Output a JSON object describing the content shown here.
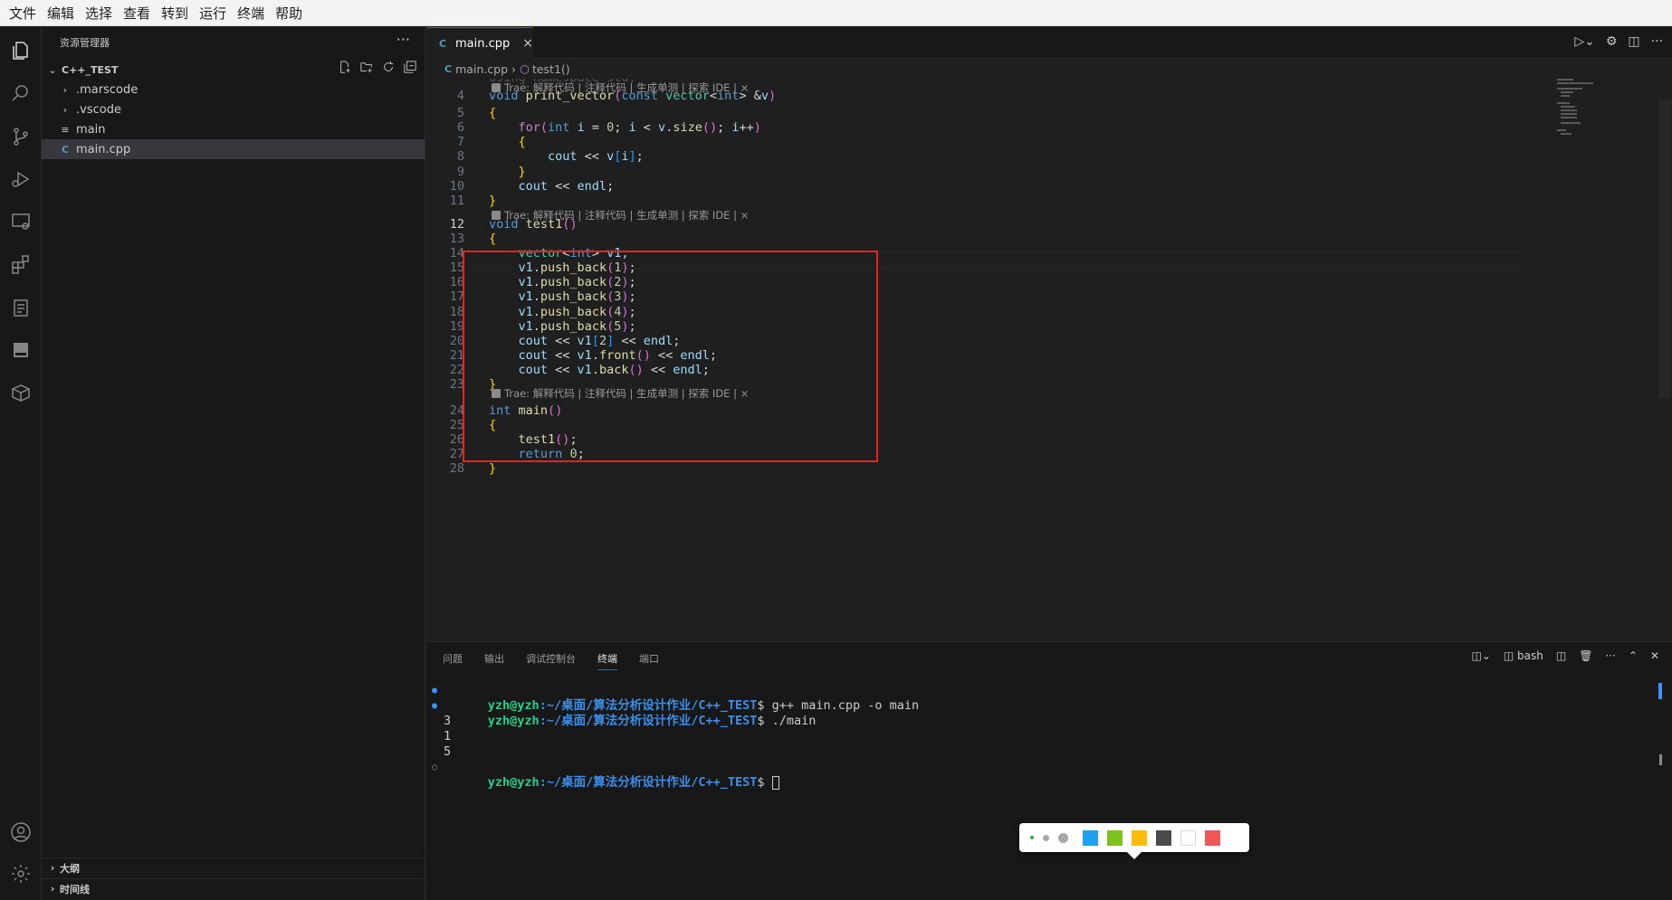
{
  "menubar": [
    "文件",
    "编辑",
    "选择",
    "查看",
    "转到",
    "运行",
    "终端",
    "帮助"
  ],
  "sidebar": {
    "title": "资源管理器",
    "more": "···",
    "folder": "C++_TEST",
    "items": [
      {
        "label": ".marscode",
        "icon": "›"
      },
      {
        "label": ".vscode",
        "icon": "›"
      },
      {
        "label": "main",
        "icon": "≡"
      },
      {
        "label": "main.cpp",
        "icon": "C"
      }
    ],
    "bottom": [
      "大纲",
      "时间线"
    ]
  },
  "tab": {
    "label": "main.cpp",
    "close": "×"
  },
  "breadcrumb": {
    "file": "main.cpp",
    "symbol": "test1()"
  },
  "codelens": "Trae: 解释代码 | 注释代码 | 生成单测 | 探索 IDE | ×",
  "code": {
    "lines": [
      {
        "n": "4",
        "t": "void print_vector(const vector<int> &v)"
      },
      {
        "n": "5",
        "t": "{"
      },
      {
        "n": "6",
        "t": "    for(int i = 0; i < v.size(); i++)"
      },
      {
        "n": "7",
        "t": "    {"
      },
      {
        "n": "8",
        "t": "        cout << v[i];"
      },
      {
        "n": "9",
        "t": "    }"
      },
      {
        "n": "10",
        "t": "    cout << endl;"
      },
      {
        "n": "11",
        "t": "}"
      },
      {
        "n": "12",
        "t": "void test1()"
      },
      {
        "n": "13",
        "t": "{"
      },
      {
        "n": "14",
        "t": "    vector<int> v1;"
      },
      {
        "n": "15",
        "t": "    v1.push_back(1);"
      },
      {
        "n": "16",
        "t": "    v1.push_back(2);"
      },
      {
        "n": "17",
        "t": "    v1.push_back(3);"
      },
      {
        "n": "18",
        "t": "    v1.push_back(4);"
      },
      {
        "n": "19",
        "t": "    v1.push_back(5);"
      },
      {
        "n": "20",
        "t": "    cout << v1[2] << endl;"
      },
      {
        "n": "21",
        "t": "    cout << v1.front() << endl;"
      },
      {
        "n": "22",
        "t": "    cout << v1.back() << endl;"
      },
      {
        "n": "23",
        "t": "}"
      },
      {
        "n": "24",
        "t": "int main()"
      },
      {
        "n": "25",
        "t": "{"
      },
      {
        "n": "26",
        "t": "    test1();"
      },
      {
        "n": "27",
        "t": "    return 0;"
      },
      {
        "n": "28",
        "t": "}"
      }
    ],
    "top_partial": "using namespace std;"
  },
  "panel": {
    "tabs": [
      "问题",
      "输出",
      "调试控制台",
      "终端",
      "端口"
    ],
    "active_tab": "终端",
    "shell": "bash"
  },
  "terminal": {
    "user": "yzh@yzh",
    "path": ":~/桌面/算法分析设计作业/C++_TEST",
    "prompt_suffix": "$",
    "cmd1": " g++ main.cpp -o main",
    "cmd2": " ./main",
    "out": [
      "3",
      "1",
      "5"
    ]
  },
  "colors": {
    "accent": "#0078d4",
    "annotation": "#e8231f",
    "swatches": [
      "#1ea1f1",
      "#7ec21f",
      "#fbbd08",
      "#4a4a4a",
      "#ffffff",
      "#f25656"
    ]
  }
}
